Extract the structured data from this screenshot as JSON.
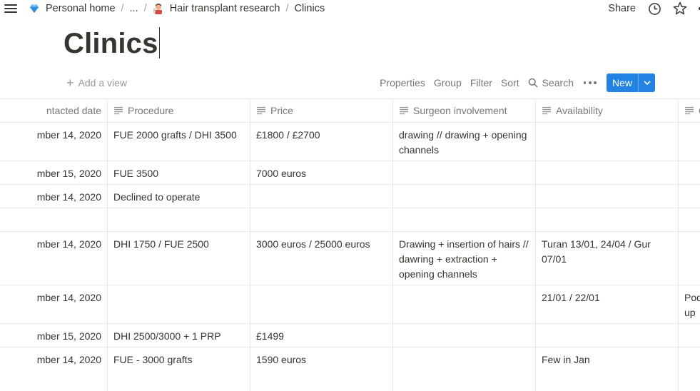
{
  "breadcrumb": {
    "items": [
      {
        "label": "Personal home",
        "icon": "diamond-icon"
      },
      {
        "label": "..."
      },
      {
        "label": "Hair transplant research",
        "icon": "barber-icon"
      },
      {
        "label": "Clinics"
      }
    ],
    "separator": "/"
  },
  "topbar": {
    "share_label": "Share"
  },
  "page": {
    "title": "Clinics"
  },
  "toolbar": {
    "add_view_label": "Add a view",
    "properties_label": "Properties",
    "group_label": "Group",
    "filter_label": "Filter",
    "sort_label": "Sort",
    "search_label": "Search",
    "new_label": "New"
  },
  "colors": {
    "accent": "#2383e2",
    "text": "#37352f",
    "muted": "#787774",
    "border": "#e9e9e7"
  },
  "table": {
    "columns": [
      {
        "label": "ntacted date"
      },
      {
        "label": "Procedure"
      },
      {
        "label": "Price"
      },
      {
        "label": "Surgeon involvement"
      },
      {
        "label": "Availability"
      },
      {
        "label": "C"
      }
    ],
    "rows": [
      {
        "date": "mber 14, 2020",
        "procedure": "FUE 2000 grafts / DHI 3500",
        "price": "£1800 / £2700",
        "surgeon": "drawing // drawing + opening channels",
        "availability": "",
        "extra": ""
      },
      {
        "date": "mber 15, 2020",
        "procedure": "FUE 3500",
        "price": "7000 euros",
        "surgeon": "",
        "availability": "",
        "extra": ""
      },
      {
        "date": "mber 14, 2020",
        "procedure": "Declined to operate",
        "price": "",
        "surgeon": "",
        "availability": "",
        "extra": ""
      },
      {
        "date": "",
        "procedure": "",
        "price": "",
        "surgeon": "",
        "availability": "",
        "extra": ""
      },
      {
        "date": "mber 14, 2020",
        "procedure": "DHI 1750 / FUE 2500",
        "price": "3000 euros / 25000 euros",
        "surgeon": "Drawing + insertion of hairs // dawring + extraction + opening channels",
        "availability": "Turan 13/01, 24/04 /  Gur 07/01",
        "extra": ""
      },
      {
        "date": "mber 14, 2020",
        "procedure": "",
        "price": "",
        "surgeon": "",
        "availability": "21/01 / 22/01",
        "extra": "Pod up"
      },
      {
        "date": "mber 15, 2020",
        "procedure": "DHI 2500/3000 + 1 PRP",
        "price": "£1499",
        "surgeon": "",
        "availability": "",
        "extra": ""
      },
      {
        "date": "mber 14, 2020",
        "procedure": "FUE  - 3000 grafts",
        "price": "1590 euros",
        "surgeon": "",
        "availability": "Few in Jan",
        "extra": ""
      }
    ]
  }
}
